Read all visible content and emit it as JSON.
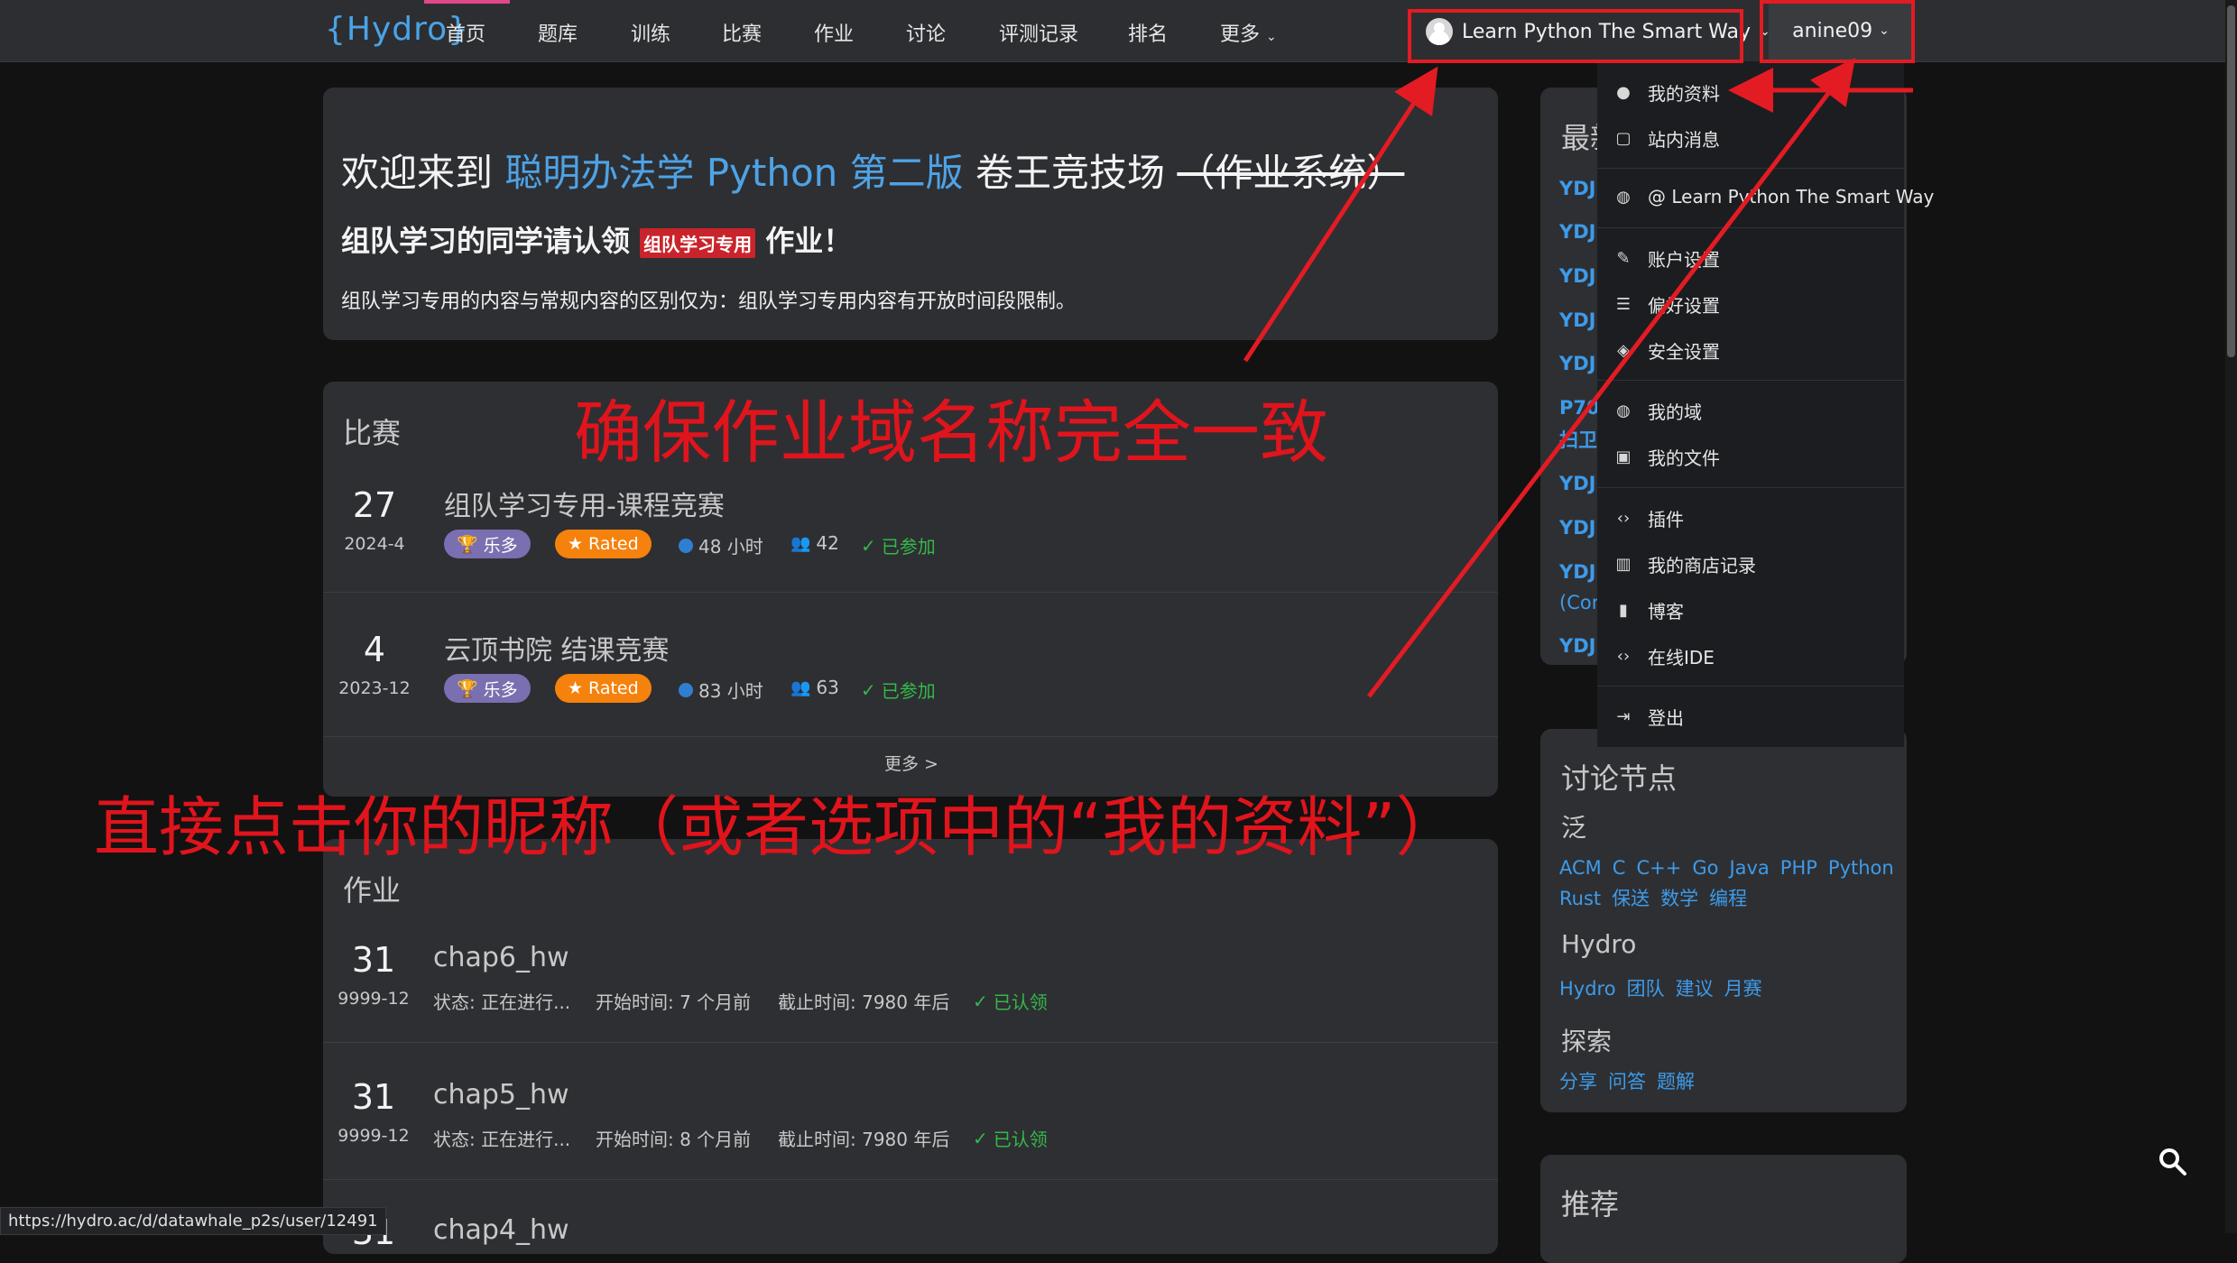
{
  "nav": {
    "logo": "{Hydro}",
    "items": [
      "首页",
      "题库",
      "训练",
      "比赛",
      "作业",
      "讨论",
      "评测记录",
      "排名",
      "更多"
    ],
    "domain_label": "Learn Python The Smart Way",
    "username": "anine09"
  },
  "hero": {
    "title_prefix": "欢迎来到 ",
    "title_blue": "聪明办法学 Python 第二版",
    "title_mid": " 卷王竞技场 ",
    "title_strike": "（作业系统）",
    "subtitle_prefix": "组队学习的同学请认领 ",
    "subtitle_tag": "组队学习专用",
    "subtitle_suffix": " 作业！",
    "note": "组队学习专用的内容与常规内容的区别仅为：组队学习专用内容有开放时间段限制。"
  },
  "contests": {
    "title": "比赛",
    "items": [
      {
        "day": "27",
        "ym": "2024-4",
        "title": "组队学习专用-课程竞赛",
        "rule": "乐多",
        "rated": "Rated",
        "duration": "48 小时",
        "count": "42",
        "status": "已参加"
      },
      {
        "day": "4",
        "ym": "2023-12",
        "title": "云顶书院 结课竞赛",
        "rule": "乐多",
        "rated": "Rated",
        "duration": "83 小时",
        "count": "63",
        "status": "已参加"
      }
    ],
    "more": "更多 >"
  },
  "homework": {
    "title": "作业",
    "items": [
      {
        "day": "31",
        "ym": "9999-12",
        "title": "chap6_hw",
        "state": "状态: 正在进行...",
        "start": "开始时间: 7 个月前",
        "end": "截止时间: 7980 年后",
        "status": "已认领"
      },
      {
        "day": "31",
        "ym": "9999-12",
        "title": "chap5_hw",
        "state": "状态: 正在进行...",
        "start": "开始时间: 8 个月前",
        "end": "截止时间: 7980 年后",
        "status": "已认领"
      },
      {
        "day": "31",
        "ym": "",
        "title": "chap4_hw"
      }
    ]
  },
  "user_menu": {
    "items": [
      {
        "label": "我的资料",
        "icon": "user-circle-icon"
      },
      {
        "label": "站内消息",
        "icon": "message-icon"
      },
      {
        "label": "@ Learn Python The Smart Way",
        "icon": "globe-icon"
      },
      {
        "label": "账户设置",
        "icon": "wrench-icon"
      },
      {
        "label": "偏好设置",
        "icon": "sliders-icon"
      },
      {
        "label": "安全设置",
        "icon": "shield-icon"
      },
      {
        "label": "我的域",
        "icon": "globe-icon"
      },
      {
        "label": "我的文件",
        "icon": "image-file-icon"
      },
      {
        "label": "插件",
        "icon": "code-icon"
      },
      {
        "label": "我的商店记录",
        "icon": "bar-chart-icon"
      },
      {
        "label": "博客",
        "icon": "book-icon"
      },
      {
        "label": "在线IDE",
        "icon": "code-icon"
      },
      {
        "label": "登出",
        "icon": "logout-icon"
      }
    ]
  },
  "sidebar": {
    "recent_title": "最新",
    "recent_items": [
      "YDJS",
      "YDJS",
      "YDJS",
      "YDJS",
      "YDJS",
      "P70",
      "YDJS",
      "YDJS",
      "YDJS",
      "YDJS"
    ],
    "recent_extra": [
      "扫卫",
      "(Cor"
    ],
    "discussion_title": "讨论节点",
    "groups": [
      {
        "name": "泛",
        "tags": [
          "ACM",
          "C",
          "C++",
          "Go",
          "Java",
          "PHP",
          "Python",
          "Rust",
          "保送",
          "数学",
          "编程"
        ]
      },
      {
        "name": "Hydro",
        "tags": [
          "Hydro",
          "团队",
          "建议",
          "月赛"
        ]
      },
      {
        "name": "探索",
        "tags": [
          "分享",
          "问答",
          "题解"
        ]
      }
    ],
    "recommend_title": "推荐"
  },
  "annotations": {
    "a1": "确保作业域名称完全一致",
    "a2": "直接点击你的昵称（或者选项中的“我的资料”）"
  },
  "status_url": "https://hydro.ac/d/datawhale_p2s/user/12491",
  "colors": {
    "accent_blue": "#4ea3e6",
    "annotation_red": "#e31b23",
    "success_green": "#34b84a",
    "rated_orange": "#f5820d",
    "rule_purple": "#7a6fb0"
  }
}
